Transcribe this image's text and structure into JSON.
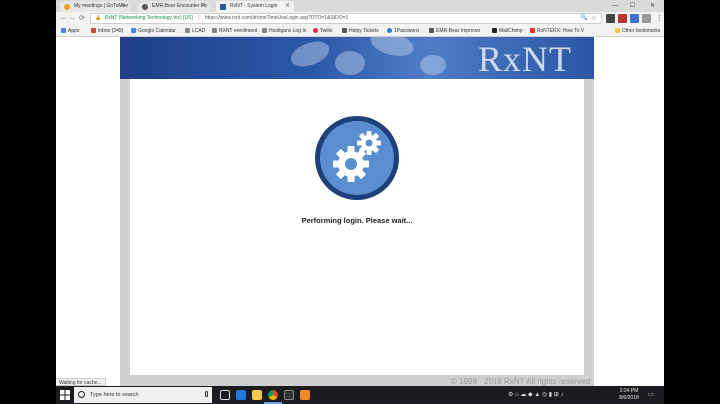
{
  "tabs": [
    {
      "title": "My meetings | GoToMee",
      "active": false,
      "color": "#f59a23"
    },
    {
      "title": "EMR-Bear Encounter Fo",
      "active": false,
      "color": "#555555"
    },
    {
      "title": "RxNT - System Login",
      "active": true,
      "color": "#2a56a4"
    }
  ],
  "address": {
    "secure_label": "RxNT (Networking Technology Inc) [US]",
    "url": "https://www.rxnt.com/dr/oneTimeUseLogin.asp?DTO=1&SIDO=1"
  },
  "bookmarks": [
    {
      "label": "Apps",
      "color": "#4a86e8"
    },
    {
      "label": "Inbox (349)",
      "color": "#d44638"
    },
    {
      "label": "Google Calendar",
      "color": "#4285f4"
    },
    {
      "label": "LCAD",
      "color": "#888888"
    },
    {
      "label": "RXNT enrollment",
      "color": "#888888"
    },
    {
      "label": "Hooligans Log In",
      "color": "#888888"
    },
    {
      "label": "Twilio",
      "color": "#e22c3c"
    },
    {
      "label": "Helpy Tickets",
      "color": "#555555"
    },
    {
      "label": "1Password",
      "color": "#2c7fd6"
    },
    {
      "label": "EMR-Bear Improver",
      "color": "#555555"
    },
    {
      "label": "MailChimp",
      "color": "#222222"
    },
    {
      "label": "RxNTERX: How To V",
      "color": "#e52d27"
    },
    {
      "label": "Other bookmarks",
      "color": "#f2c94c"
    }
  ],
  "page": {
    "brand_logo": "RxNT",
    "loading_message": "Performing login. Please wait...",
    "copyright": "© 1998 - 2018  RxNT All rights reserved",
    "status_text": "Waiting for cache..."
  },
  "taskbar": {
    "search_placeholder": "Type here to search",
    "time": "2:24 PM",
    "date": "8/6/2018"
  },
  "colors": {
    "brand_blue": "#2a56a4",
    "gear_circle": "#2b5797",
    "gear_inner": "#5a8ed0"
  }
}
